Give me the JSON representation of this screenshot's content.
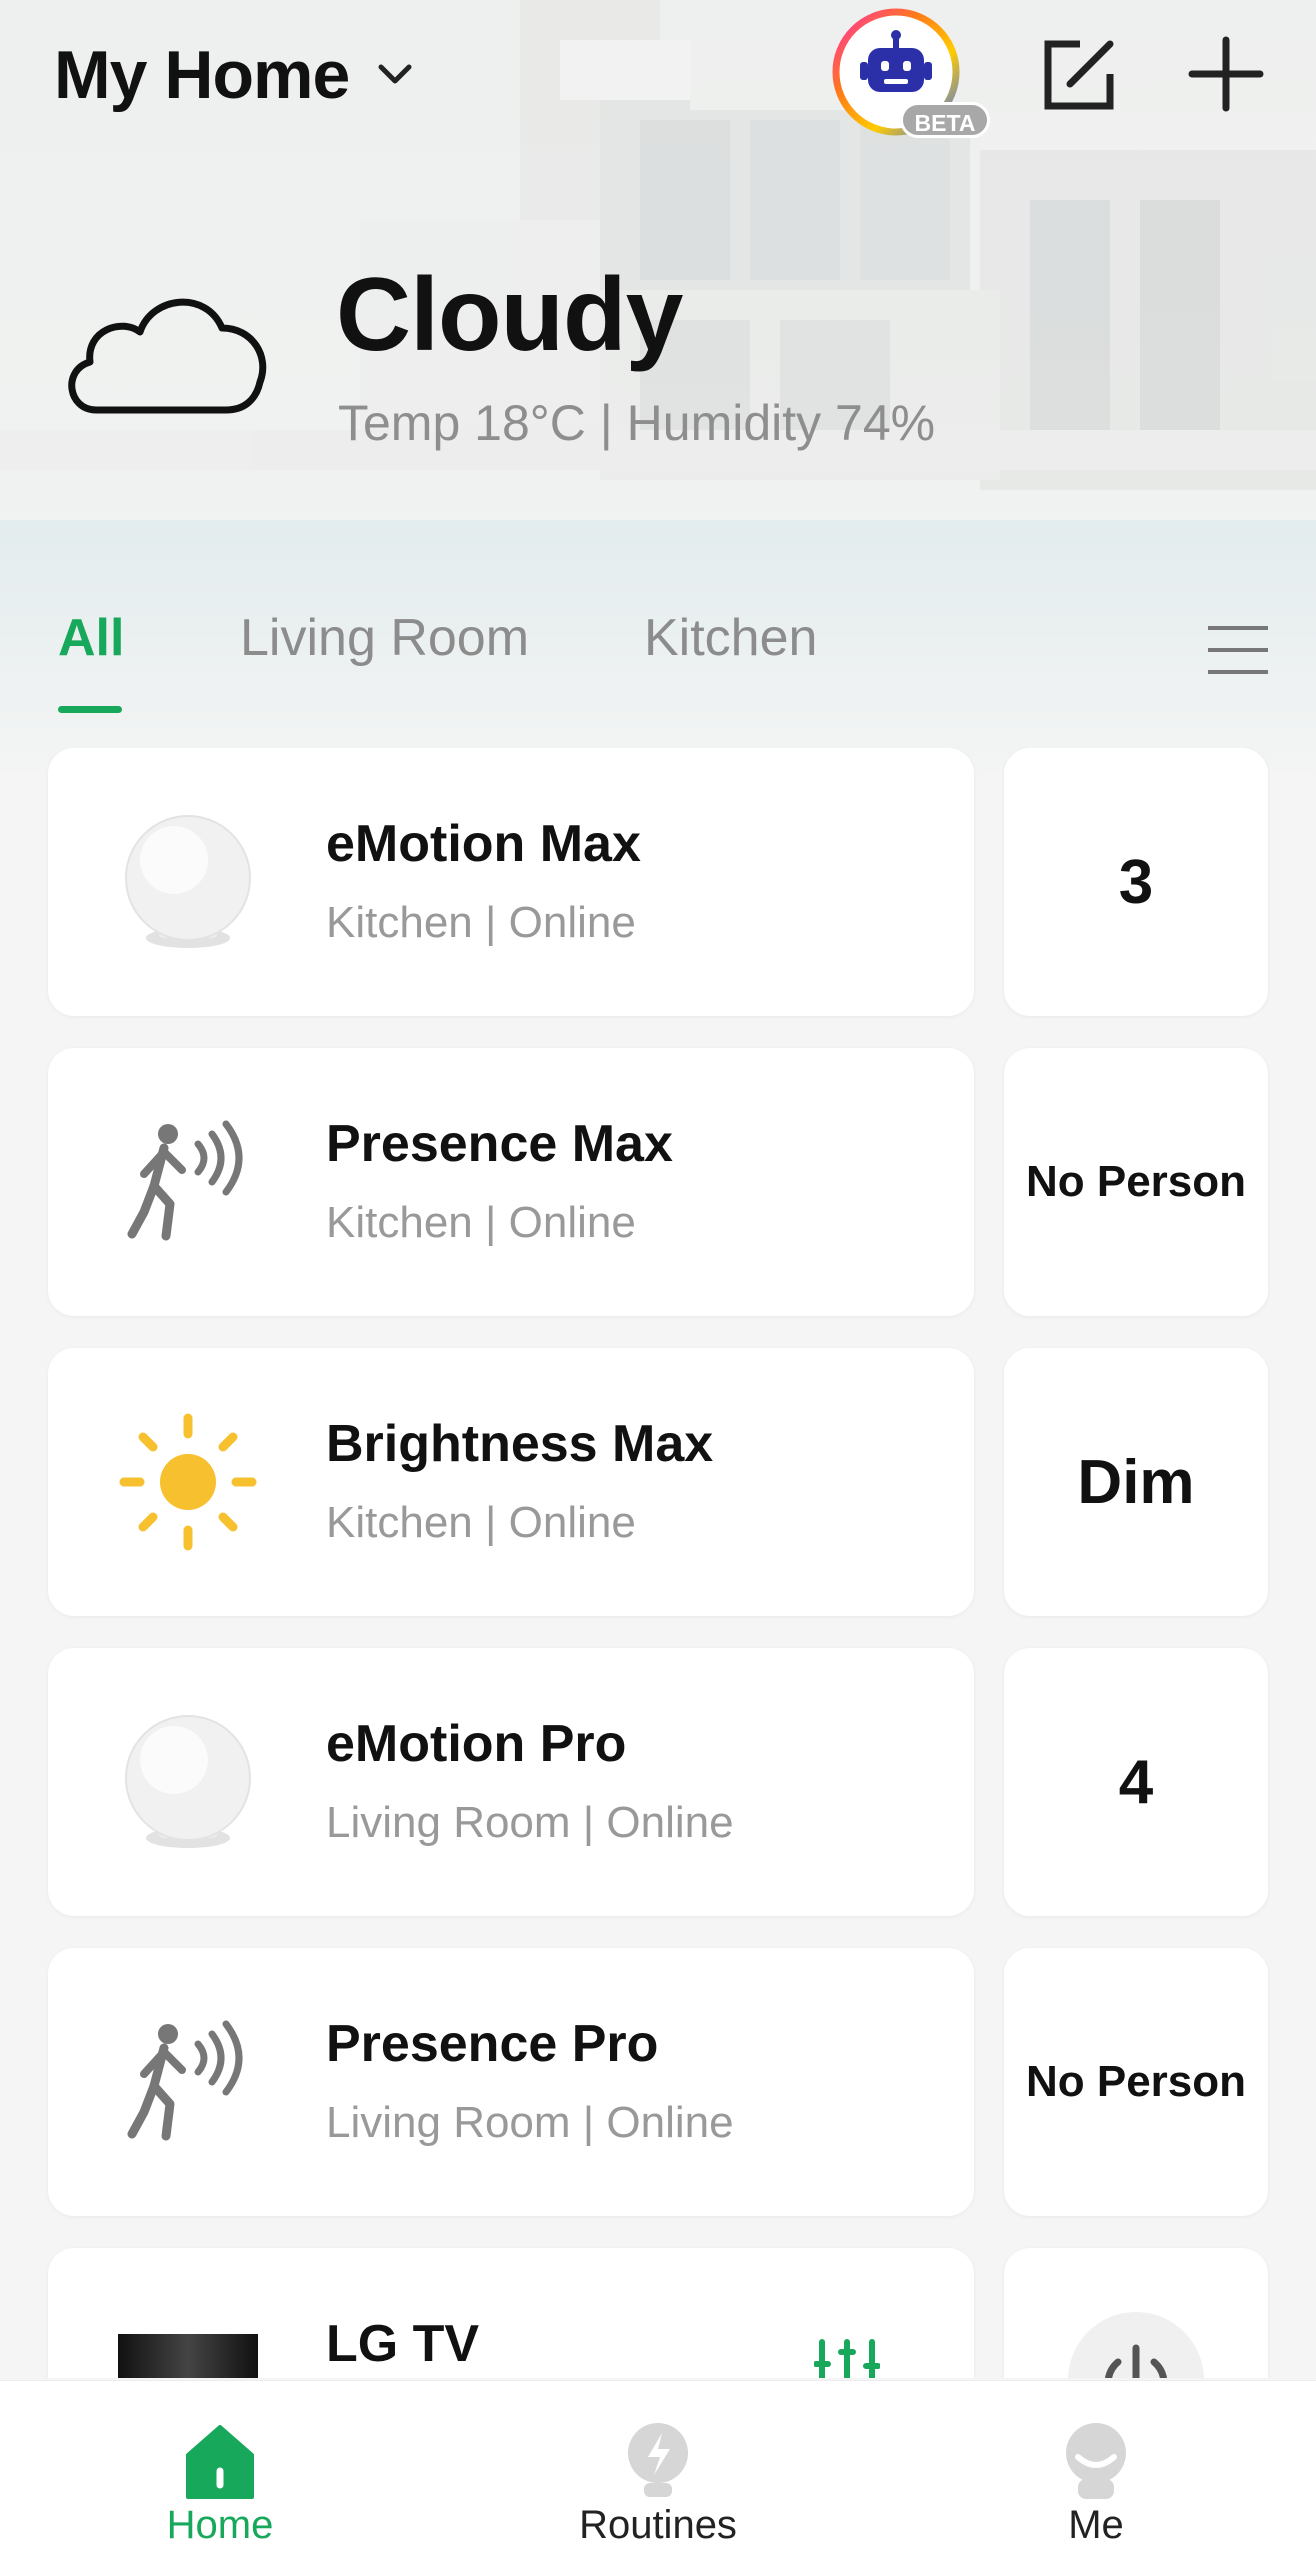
{
  "header": {
    "home_name": "My Home",
    "ai_badge": "BETA",
    "icons": {
      "home_switch": "chevron-down-icon",
      "assistant": "robot-icon",
      "edit": "edit-icon",
      "add": "plus-icon"
    }
  },
  "weather": {
    "condition": "Cloudy",
    "details": "Temp 18°C | Humidity 74%",
    "icon": "cloud-icon"
  },
  "tabs": {
    "items": [
      {
        "label": "All",
        "active": true
      },
      {
        "label": "Living Room",
        "active": false
      },
      {
        "label": "Kitchen",
        "active": false
      }
    ],
    "menu_icon": "hamburger-icon"
  },
  "devices": [
    {
      "name": "eMotion Max",
      "subtitle": "Kitchen | Online",
      "status": "3",
      "icon": "sphere-sensor-icon"
    },
    {
      "name": "Presence Max",
      "subtitle": "Kitchen | Online",
      "status": "No Person",
      "icon": "presence-walker-icon"
    },
    {
      "name": "Brightness Max",
      "subtitle": "Kitchen | Online",
      "status": "Dim",
      "icon": "sun-icon"
    },
    {
      "name": "eMotion Pro",
      "subtitle": "Living Room | Online",
      "status": "4",
      "icon": "sphere-sensor-icon"
    },
    {
      "name": "Presence Pro",
      "subtitle": "Living Room | Online",
      "status": "No Person",
      "icon": "presence-walker-icon"
    },
    {
      "name": "LG TV",
      "subtitle": "",
      "status": "",
      "icon": "tv-icon",
      "action_icon": "equalizer-icon",
      "status_icon": "power-icon"
    }
  ],
  "bottom_nav": [
    {
      "label": "Home",
      "active": true,
      "icon": "home-icon"
    },
    {
      "label": "Routines",
      "active": false,
      "icon": "lightbulb-bolt-icon"
    },
    {
      "label": "Me",
      "active": false,
      "icon": "user-icon"
    }
  ],
  "colors": {
    "accent": "#17a85b",
    "sun": "#f7c02f",
    "text_primary": "#111111",
    "text_secondary": "#999999"
  }
}
